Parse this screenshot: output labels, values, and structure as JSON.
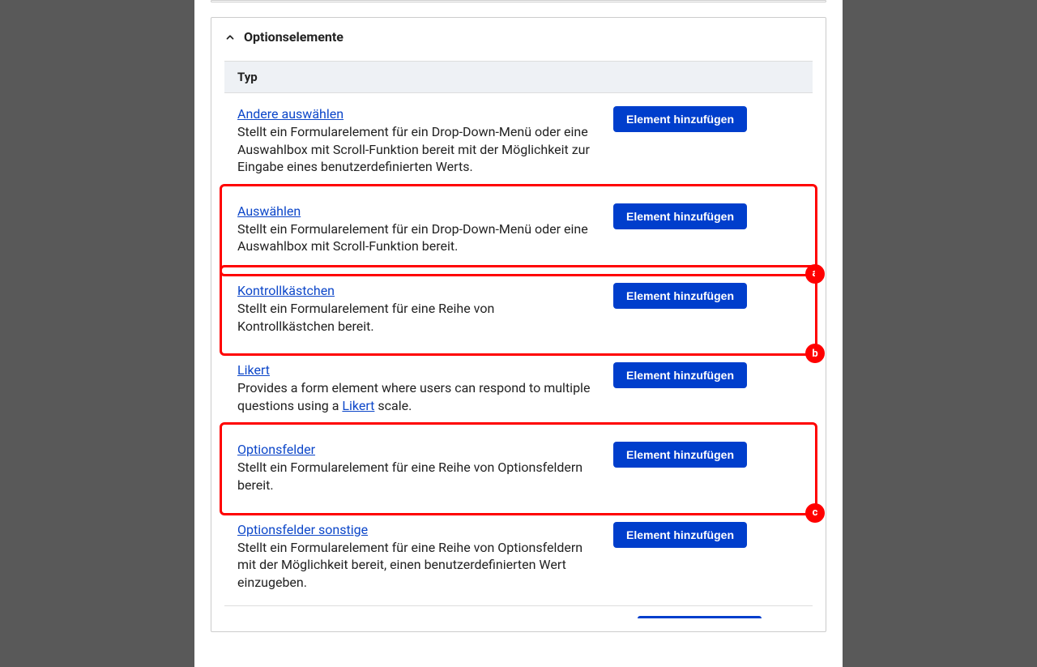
{
  "section": {
    "title": "Optionselemente",
    "column_header": "Typ",
    "add_button_label": "Element hinzufügen"
  },
  "items": [
    {
      "title": "Andere auswählen",
      "desc": "Stellt ein Formularelement für ein Drop-Down-Menü oder eine Auswahlbox mit Scroll-Funktion bereit mit der Möglichkeit zur Eingabe eines benutzerdefinierten Werts."
    },
    {
      "title": "Auswählen",
      "desc": "Stellt ein Formularelement für ein Drop-Down-Menü oder eine Auswahlbox mit Scroll-Funktion bereit."
    },
    {
      "title": "Kontrollkästchen",
      "desc": "Stellt ein Formularelement für eine Reihe von Kontrollkästchen bereit."
    },
    {
      "title": "Likert",
      "desc_pre": "Provides a form element where users can respond to multiple questions using a ",
      "desc_link": "Likert",
      "desc_post": " scale."
    },
    {
      "title": "Optionsfelder",
      "desc": "Stellt ein Formularelement für eine Reihe von Optionsfeldern bereit."
    },
    {
      "title": "Optionsfelder sonstige",
      "desc": "Stellt ein Formularelement für eine Reihe von Optionsfeldern mit der Möglichkeit bereit, einen benutzerdefinierten Wert einzugeben."
    }
  ],
  "annotations": {
    "a": "a",
    "b": "b",
    "c": "c"
  }
}
